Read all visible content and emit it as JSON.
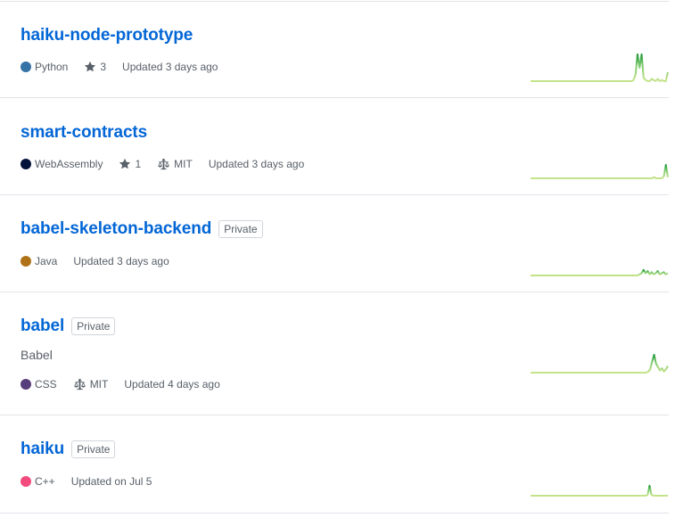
{
  "colors": {
    "link": "#0366d6",
    "spark": "#c6e48b",
    "spark_dark": "#7bc96f"
  },
  "repos": [
    {
      "name": "haiku-node-prototype",
      "private_badge": "",
      "description": "",
      "language": "Python",
      "language_color": "#3572A5",
      "stars": "3",
      "license": "",
      "updated": "Updated 3 days ago",
      "activity": [
        0,
        0,
        0,
        0,
        0,
        0,
        0,
        0,
        0,
        0,
        0,
        0,
        0,
        0,
        0,
        0,
        0,
        0,
        0,
        0,
        0,
        0,
        0,
        0,
        0,
        0,
        0,
        0,
        0,
        0,
        0,
        0,
        0,
        0,
        0,
        0,
        0,
        0,
        0,
        0,
        0,
        0,
        0,
        0,
        0,
        0,
        0,
        0,
        0,
        0,
        0,
        1,
        6,
        24,
        12,
        24,
        3,
        1,
        0,
        0,
        2,
        1,
        0,
        2,
        0,
        1,
        0,
        0,
        8
      ]
    },
    {
      "name": "smart-contracts",
      "private_badge": "",
      "description": "",
      "language": "WebAssembly",
      "language_color": "#04133b",
      "stars": "1",
      "license": "MIT",
      "updated": "Updated 3 days ago",
      "activity": [
        0,
        0,
        0,
        0,
        0,
        0,
        0,
        0,
        0,
        0,
        0,
        0,
        0,
        0,
        0,
        0,
        0,
        0,
        0,
        0,
        0,
        0,
        0,
        0,
        0,
        0,
        0,
        0,
        0,
        0,
        0,
        0,
        0,
        0,
        0,
        0,
        0,
        0,
        0,
        0,
        0,
        0,
        0,
        0,
        0,
        0,
        0,
        0,
        0,
        0,
        0,
        0,
        0,
        0,
        0,
        0,
        0,
        0,
        0,
        0,
        0,
        0,
        0,
        1,
        0,
        0,
        0,
        0,
        2,
        12,
        1
      ]
    },
    {
      "name": "babel-skeleton-backend",
      "private_badge": "Private",
      "description": "",
      "language": "Java",
      "language_color": "#b07219",
      "stars": "",
      "license": "",
      "updated": "Updated 3 days ago",
      "activity": [
        0,
        0,
        0,
        0,
        0,
        0,
        0,
        0,
        0,
        0,
        0,
        0,
        0,
        0,
        0,
        0,
        0,
        0,
        0,
        0,
        0,
        0,
        0,
        0,
        0,
        0,
        0,
        0,
        0,
        0,
        0,
        0,
        0,
        0,
        0,
        0,
        0,
        0,
        0,
        0,
        0,
        0,
        0,
        0,
        0,
        0,
        0,
        0,
        0,
        0,
        0,
        0,
        0,
        0,
        1,
        2,
        5,
        2,
        4,
        1,
        3,
        1,
        2,
        4,
        1,
        2,
        3,
        1,
        2
      ]
    },
    {
      "name": "babel",
      "private_badge": "Private",
      "description": "Babel",
      "language": "CSS",
      "language_color": "#563d7c",
      "stars": "",
      "license": "MIT",
      "updated": "Updated 4 days ago",
      "activity": [
        0,
        0,
        0,
        0,
        0,
        0,
        0,
        0,
        0,
        0,
        0,
        0,
        0,
        0,
        0,
        0,
        0,
        0,
        0,
        0,
        0,
        0,
        0,
        0,
        0,
        0,
        0,
        0,
        0,
        0,
        0,
        0,
        0,
        0,
        0,
        0,
        0,
        0,
        0,
        0,
        0,
        0,
        0,
        0,
        0,
        0,
        0,
        0,
        0,
        0,
        0,
        0,
        0,
        0,
        0,
        0,
        0,
        0,
        0,
        0,
        1,
        3,
        10,
        16,
        8,
        5,
        2,
        4,
        1,
        3,
        6
      ]
    },
    {
      "name": "haiku",
      "private_badge": "Private",
      "description": "",
      "language": "C++",
      "language_color": "#f34b7d",
      "stars": "",
      "license": "",
      "updated": "Updated on Jul 5",
      "activity": [
        0,
        0,
        0,
        0,
        0,
        0,
        0,
        0,
        0,
        0,
        0,
        0,
        0,
        0,
        0,
        0,
        0,
        0,
        0,
        0,
        0,
        0,
        0,
        0,
        0,
        0,
        0,
        0,
        0,
        0,
        0,
        0,
        0,
        0,
        0,
        0,
        0,
        0,
        0,
        0,
        0,
        0,
        0,
        0,
        0,
        0,
        0,
        0,
        0,
        0,
        0,
        0,
        0,
        0,
        0,
        0,
        0,
        0,
        0,
        0,
        0,
        0,
        0,
        0,
        1,
        9,
        1,
        0,
        0,
        0,
        0,
        0,
        0,
        0,
        0,
        0
      ]
    }
  ]
}
